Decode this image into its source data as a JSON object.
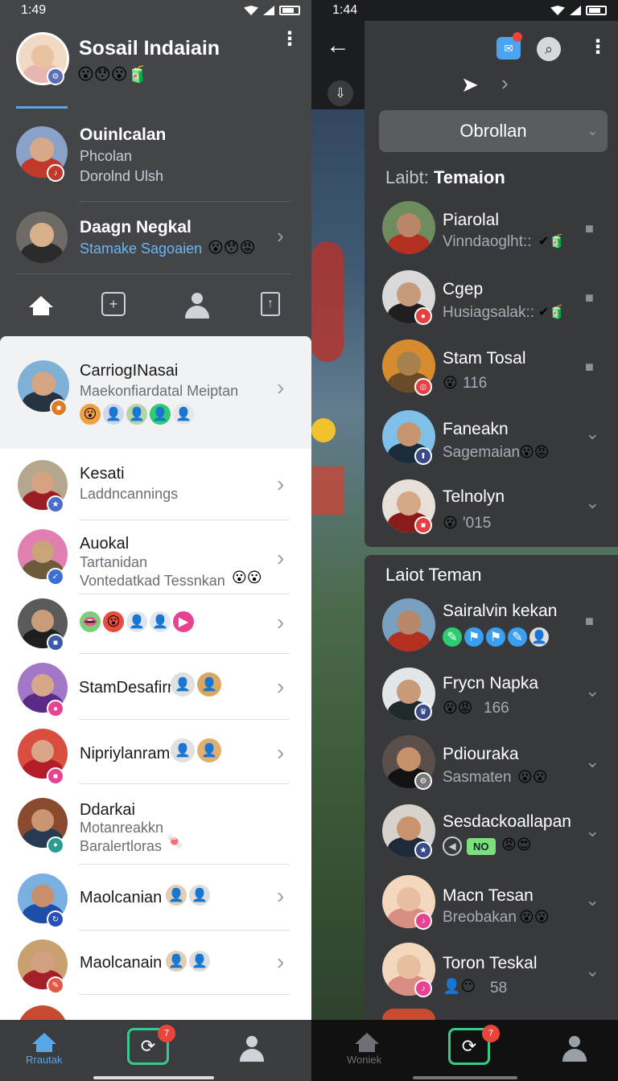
{
  "status_left": {
    "time": "1:49"
  },
  "status_right": {
    "time": "1:44"
  },
  "left": {
    "header": {
      "name": "Sosail Indaiain",
      "emojis": "😮😯😮🧃"
    },
    "featured": [
      {
        "title": "Ouinlcalan",
        "line1": "Phcolan",
        "line2": "Dorolnd Ulsh"
      },
      {
        "title": "Daagn Negkal",
        "line1": "Stamake Sagoaien",
        "emojis": "😮😯😡"
      }
    ],
    "list": [
      {
        "title": "CarriogINasai",
        "subtitle": "Maekonfiardatal Meiptan"
      },
      {
        "title": "Kesati",
        "subtitle": "Laddncannings"
      },
      {
        "title": "Auokal",
        "line1": "Tartanidan",
        "line2": "Vontedatkad Tessnkan"
      },
      {
        "title": ""
      },
      {
        "title": "StamDesafirn"
      },
      {
        "title": "Nipriylanram"
      },
      {
        "title": "Ddarkai",
        "line1": "Motanreakkn",
        "line2": "Baralertloras"
      },
      {
        "title": "Maolcanian"
      },
      {
        "title": "Maolcanain"
      }
    ],
    "nav": {
      "home_label": "Rrautak",
      "notif": "7"
    }
  },
  "right": {
    "dropdown": "Obrollan",
    "section1": {
      "prefix": "Laibt:",
      "title": "Temaion"
    },
    "section1_items": [
      {
        "name": "Piarolal",
        "sub": "Vinndaoglht::"
      },
      {
        "name": "Cgep",
        "sub": "Husiagsalak::"
      },
      {
        "name": "Stam Tosal",
        "sub": "116"
      },
      {
        "name": "Faneakn",
        "sub": "Sagemaian"
      },
      {
        "name": "Telnolyn",
        "sub": "'015"
      }
    ],
    "section2": {
      "prefix": "Laiot",
      "title": "Teman"
    },
    "section2_items": [
      {
        "name": "Sairalvin kekan",
        "sub": ""
      },
      {
        "name": "Frycn Napka",
        "sub": "166"
      },
      {
        "name": "Pdiouraka",
        "sub": "Sasmaten"
      },
      {
        "name": "Sesdackoallapan",
        "sub": "NO"
      },
      {
        "name": "Macn Tesan",
        "sub": "Breobakan"
      },
      {
        "name": "Toron Teskal",
        "sub": "58"
      }
    ],
    "nav": {
      "home_label": "Woniek",
      "notif": "7"
    }
  },
  "colors": {
    "accent": "#5aa7e8",
    "green": "#39c98a",
    "panel": "#38393c",
    "left_bg": "#434549"
  }
}
